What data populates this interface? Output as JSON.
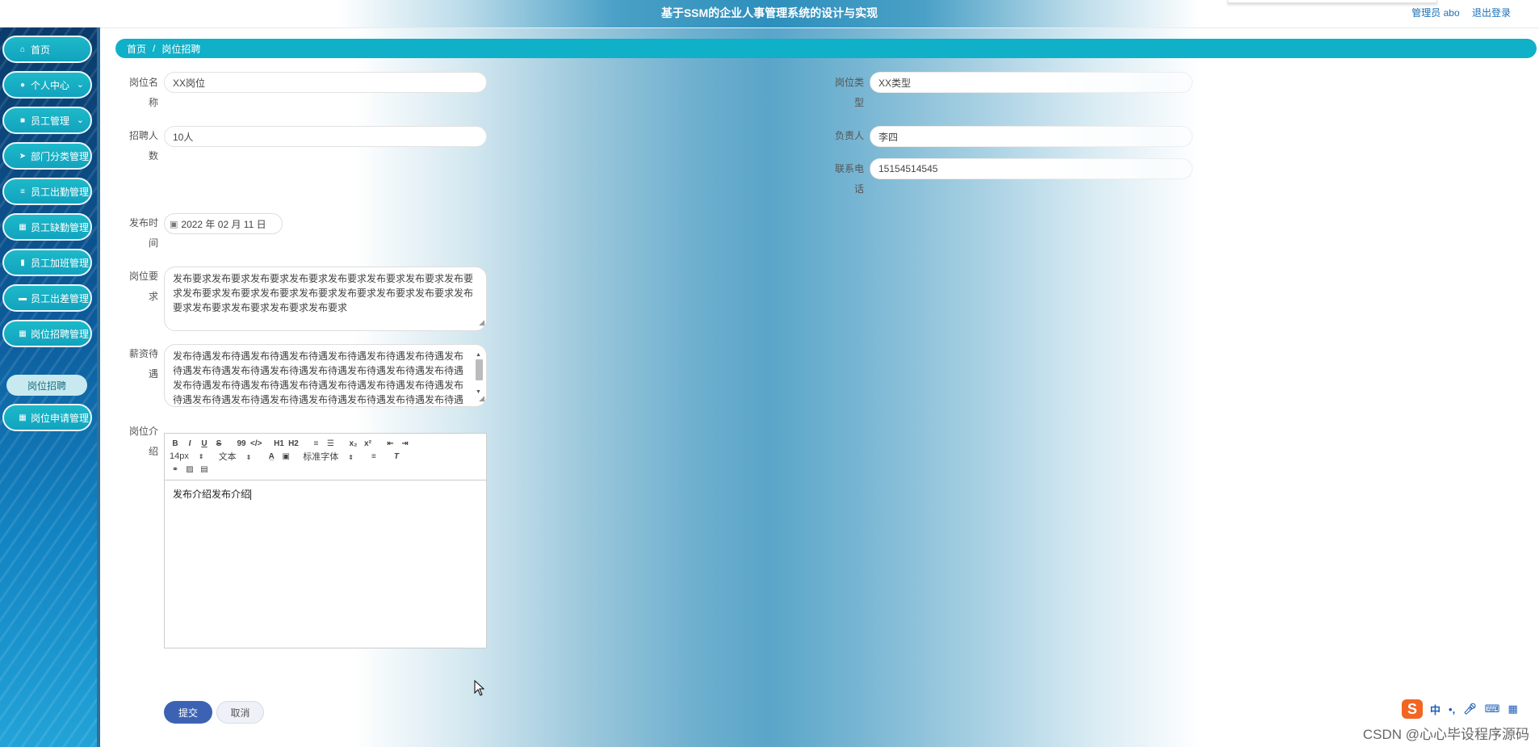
{
  "header": {
    "title": "基于SSM的企业人事管理系统的设计与实现",
    "admin_label": "管理员 abo",
    "logout_label": "退出登录"
  },
  "sidebar": {
    "items": [
      {
        "label": "首页",
        "icon": "home-icon"
      },
      {
        "label": "个人中心",
        "icon": "user-icon"
      },
      {
        "label": "员工管理",
        "icon": "square-icon"
      },
      {
        "label": "部门分类管理",
        "icon": "send-icon"
      },
      {
        "label": "员工出勤管理",
        "icon": "list-icon"
      },
      {
        "label": "员工缺勤管理",
        "icon": "grid-icon"
      },
      {
        "label": "员工加班管理",
        "icon": "clipboard-icon"
      },
      {
        "label": "员工出差管理",
        "icon": "comment-icon"
      },
      {
        "label": "岗位招聘管理",
        "icon": "grid-icon"
      },
      {
        "label": "岗位申请管理",
        "icon": "grid-icon"
      }
    ],
    "sub_item": "岗位招聘"
  },
  "breadcrumb": {
    "home": "首页",
    "separator": "/",
    "current": "岗位招聘"
  },
  "form": {
    "position_name": {
      "label_line1": "岗位名",
      "label_line2": "称",
      "value": "XX岗位"
    },
    "position_type": {
      "label_line1": "岗位类",
      "label_line2": "型",
      "value": "XX类型"
    },
    "recruit_count": {
      "label_line1": "招聘人",
      "label_line2": "数",
      "value": "10人"
    },
    "manager": {
      "label": "负责人",
      "value": "李四"
    },
    "phone": {
      "label_line1": "联系电",
      "label_line2": "话",
      "value": "15154514545"
    },
    "publish_time": {
      "label_line1": "发布时",
      "label_line2": "间",
      "value": "2022 年 02 月 11 日"
    },
    "requirements": {
      "label_line1": "岗位要",
      "label_line2": "求",
      "value": "发布要求发布要求发布要求发布要求发布要求发布要求发布要求发布要求发布要求发布要求发布要求发布要求发布要求发布要求发布要求发布要求发布要求发布要求发布要求发布要求"
    },
    "salary": {
      "label_line1": "薪资待",
      "label_line2": "遇",
      "value": "发布待遇发布待遇发布待遇发布待遇发布待遇发布待遇发布待遇发布待遇发布待遇发布待遇发布待遇发布待遇发布待遇发布待遇发布待遇发布待遇发布待遇发布待遇发布待遇发布待遇发布待遇发布待遇发布待遇发布待遇发布待遇发布待遇发布待遇发布待遇发布待遇发布待遇发布待遇"
    },
    "intro": {
      "label_line1": "岗位介",
      "label_line2": "绍",
      "value": "发布介绍发布介绍",
      "toolbar": {
        "row1": [
          "B",
          "I",
          "U",
          "S",
          "99",
          "</>",
          "H1",
          "H2",
          "≡",
          "☰",
          "x₂",
          "x²",
          "⇤",
          "⇥"
        ],
        "font_size": "14px",
        "text_type": "文本",
        "font_family": "标准字体"
      }
    }
  },
  "buttons": {
    "submit": "提交",
    "cancel": "取消"
  },
  "ime": {
    "logo": "S",
    "lang": "中",
    "punct": "•,"
  },
  "watermark": "CSDN @心心毕设程序源码"
}
